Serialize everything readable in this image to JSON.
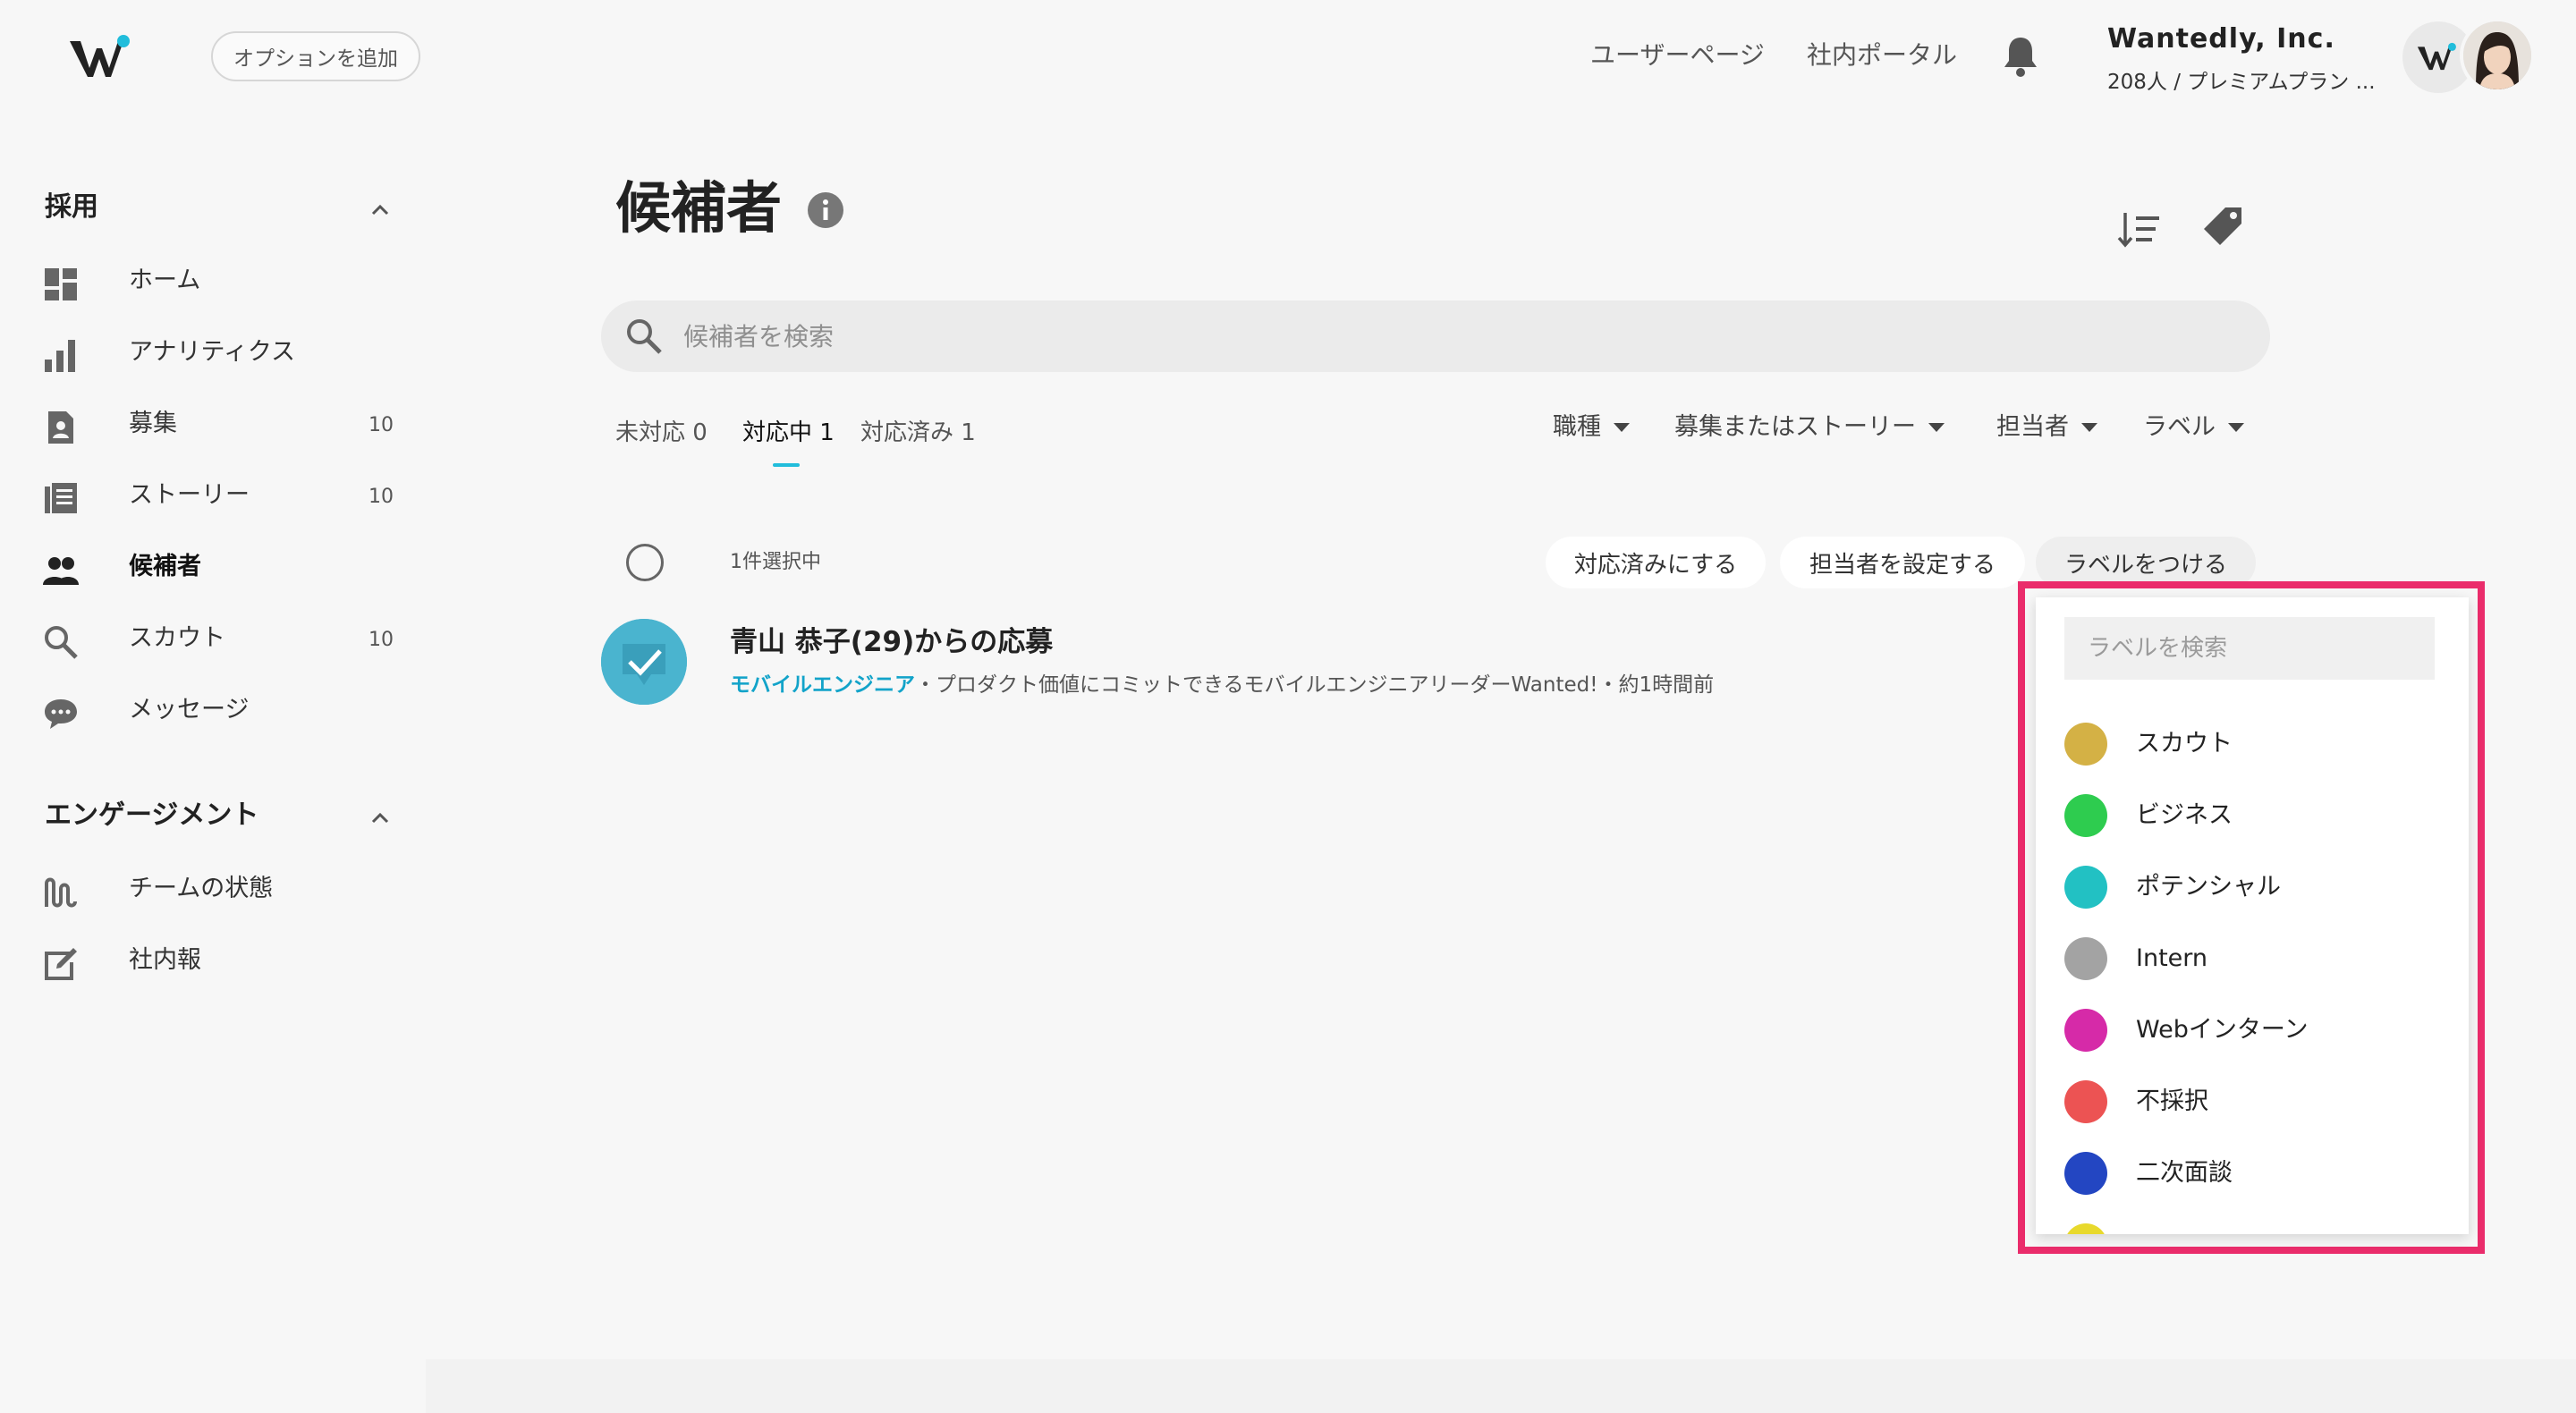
{
  "header": {
    "add_option": "オプションを追加",
    "user_page": "ユーザーページ",
    "portal": "社内ポータル",
    "company_name": "Wantedly, Inc.",
    "company_plan": "208人 / プレミアムプラン ...",
    "brand_color": "#21bddb"
  },
  "sidebar": {
    "sections": [
      {
        "title": "採用",
        "items": [
          {
            "label": "ホーム",
            "icon": "dashboard-icon",
            "count": ""
          },
          {
            "label": "アナリティクス",
            "icon": "bar-chart-icon",
            "count": ""
          },
          {
            "label": "募集",
            "icon": "document-icon",
            "count": "10"
          },
          {
            "label": "ストーリー",
            "icon": "story-icon",
            "count": "10"
          },
          {
            "label": "候補者",
            "icon": "people-icon",
            "count": ""
          },
          {
            "label": "スカウト",
            "icon": "search-icon",
            "count": "10"
          },
          {
            "label": "メッセージ",
            "icon": "chat-icon",
            "count": ""
          }
        ]
      },
      {
        "title": "エンゲージメント",
        "items": [
          {
            "label": "チームの状態",
            "icon": "wave-icon"
          },
          {
            "label": "社内報",
            "icon": "edit-icon"
          }
        ]
      }
    ]
  },
  "main": {
    "title": "候補者",
    "search_placeholder": "候補者を検索",
    "tabs": [
      {
        "label": "未対応 0"
      },
      {
        "label": "対応中 1"
      },
      {
        "label": "対応済み 1"
      }
    ],
    "filters": [
      "職種",
      "募集またはストーリー",
      "担当者",
      "ラベル"
    ],
    "selected_count": "1件選択中",
    "actions": [
      "対応済みにする",
      "担当者を設定する",
      "ラベルをつける"
    ],
    "candidate": {
      "name": "青山 恭子(29)からの応募",
      "role": "モバイルエンジニア",
      "detail": "・プロダクト価値にコミットできるモバイルエンジニアリーダーWanted!・約1時間前"
    }
  },
  "label_dropdown": {
    "search_placeholder": "ラベルを検索",
    "labels": [
      {
        "name": "スカウト",
        "color": "#d4b145"
      },
      {
        "name": "ビジネス",
        "color": "#2ecc4f"
      },
      {
        "name": "ポテンシャル",
        "color": "#22c1c3"
      },
      {
        "name": "Intern",
        "color": "#a3a3a3"
      },
      {
        "name": "Webインターン",
        "color": "#d62aa8"
      },
      {
        "name": "不採択",
        "color": "#ec5353"
      },
      {
        "name": "二次面談",
        "color": "#2346c2"
      },
      {
        "name": "",
        "color": "#e8d92c"
      }
    ],
    "highlight_color": "#ea2c6b"
  }
}
